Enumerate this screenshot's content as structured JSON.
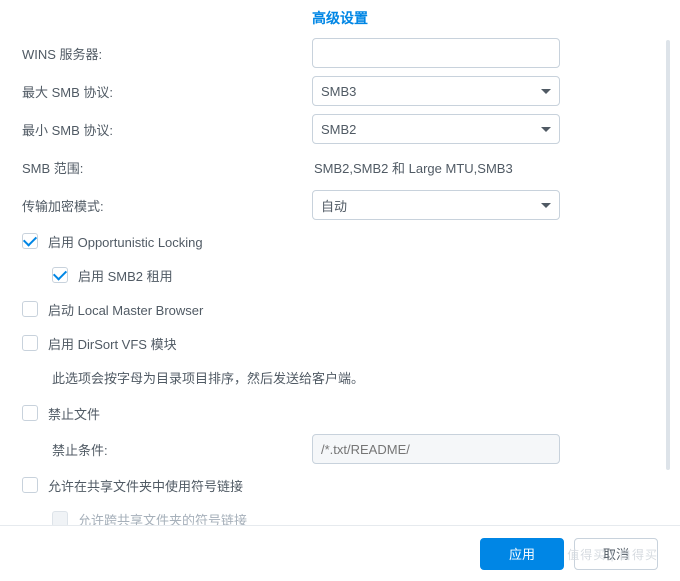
{
  "title": "高级设置",
  "fields": {
    "wins_label": "WINS 服务器:",
    "wins_value": "",
    "max_smb_label": "最大 SMB 协议:",
    "max_smb_value": "SMB3",
    "min_smb_label": "最小 SMB 协议:",
    "min_smb_value": "SMB2",
    "smb_range_label": "SMB 范围:",
    "smb_range_value": "SMB2,SMB2 和 Large MTU,SMB3",
    "encrypt_mode_label": "传输加密模式:",
    "encrypt_mode_value": "自动"
  },
  "checks": {
    "oplock": "启用 Opportunistic Locking",
    "smb2_lease": "启用 SMB2 租用",
    "local_master": "启动 Local Master Browser",
    "dirsort": "启用 DirSort VFS 模块",
    "dirsort_desc": "此选项会按字母为目录项目排序，然后发送给客户端。",
    "veto": "禁止文件",
    "veto_cond_label": "禁止条件:",
    "veto_cond_placeholder": "/*.txt/README/",
    "symlink": "允许在共享文件夹中使用符号链接",
    "symlink_cross": "允许跨共享文件夹的符号链接"
  },
  "buttons": {
    "apply": "应用",
    "cancel": "取消"
  },
  "watermark": "值得买 | 自得买"
}
